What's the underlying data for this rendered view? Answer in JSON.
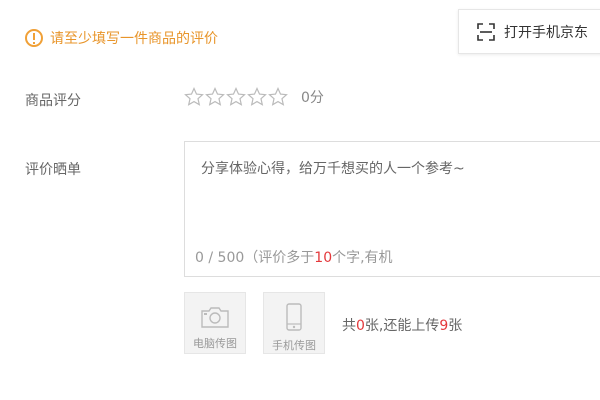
{
  "notice": {
    "text": "请至少填写一件商品的评价"
  },
  "open_app": {
    "label": "打开手机京东"
  },
  "rating": {
    "label": "商品评分",
    "max": 5,
    "value": 0,
    "score_text": "0分"
  },
  "review": {
    "label": "评价晒单",
    "placeholder": "分享体验心得，给万千想买的人一个参考~",
    "counter": {
      "current": "0",
      "sep": " / ",
      "max": "500",
      "hint_prefix": "（评价多于",
      "hint_num": "10",
      "hint_suffix": "个字,有机"
    }
  },
  "upload": {
    "pc_label": "电脑传图",
    "phone_label": "手机传图",
    "info_prefix": "共",
    "uploaded": "0",
    "info_mid": "张,还能上传",
    "remaining": "9",
    "info_suffix": "张"
  },
  "colors": {
    "warning": "#e8952a",
    "accent_red": "#e4393c",
    "border": "#dddddd"
  }
}
